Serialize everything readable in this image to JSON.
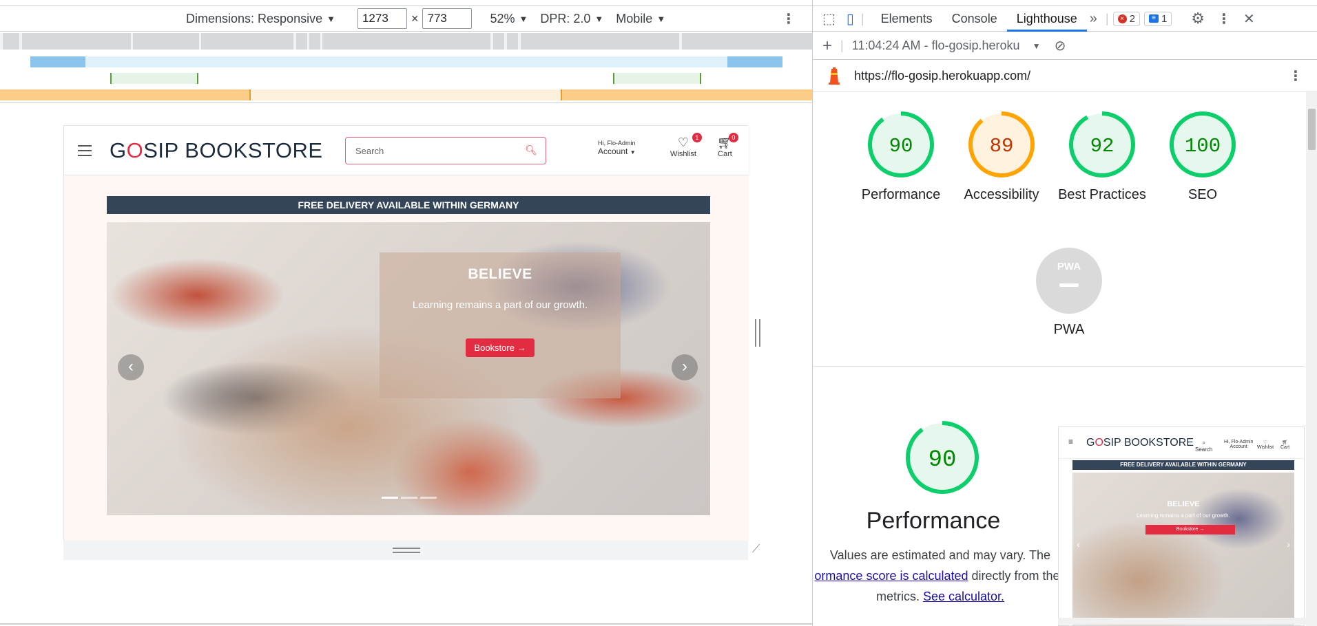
{
  "device_toolbar": {
    "dimensions_label": "Dimensions: Responsive",
    "width_value": "1273",
    "times": "×",
    "height_value": "773",
    "zoom": "52%",
    "dpr": "DPR: 2.0",
    "device_type": "Mobile"
  },
  "website": {
    "logo_g": "G",
    "logo_o": "O",
    "logo_rest": "SIP BOOKSTORE",
    "search_placeholder": "Search",
    "greeting": "Hi, Flo-Admin",
    "account_label": "Account",
    "wishlist_label": "Wishlist",
    "wishlist_count": "1",
    "cart_label": "Cart",
    "cart_count": "0",
    "delivery_banner": "FREE DELIVERY AVAILABLE WITHIN GERMANY",
    "hero_title": "BELIEVE",
    "hero_subtitle": "Learning remains a part of our growth.",
    "hero_button": "Bookstore →"
  },
  "devtools": {
    "tabs": [
      "Elements",
      "Console",
      "Lighthouse"
    ],
    "active_tab": "Lighthouse",
    "error_count": "2",
    "message_count": "1",
    "report_time": "11:04:24 AM - flo-gosip.heroku",
    "url": "https://flo-gosip.herokuapp.com/",
    "scores": [
      {
        "name": "Performance",
        "score": 90,
        "color": "#0cce6b",
        "text_color": "#008800"
      },
      {
        "name": "Accessibility",
        "score": 89,
        "color": "#ffa400",
        "text_color": "#c33300"
      },
      {
        "name": "Best Practices",
        "score": 92,
        "color": "#0cce6b",
        "text_color": "#008800"
      },
      {
        "name": "SEO",
        "score": 100,
        "color": "#0cce6b",
        "text_color": "#008800"
      }
    ],
    "pwa_badge": "PWA",
    "pwa_label": "PWA",
    "perf_score": "90",
    "perf_title": "Performance",
    "perf_desc_1": "Values are estimated and may vary. The",
    "perf_desc_link": "ormance score is calculated",
    "perf_desc_2": "directly from thes",
    "perf_desc_3": "metrics.",
    "perf_desc_calc": "See calculator.",
    "thumb": {
      "logo_g": "G",
      "logo_o": "O",
      "logo_rest": "SIP BOOKSTORE",
      "search": "Search",
      "greeting": "Hi, Flo-Admin",
      "account": "Account",
      "wishlist": "Wishlist",
      "cart": "Cart",
      "banner": "FREE DELIVERY AVAILABLE WITHIN GERMANY",
      "title": "BELIEVE",
      "subtitle": "Learning remains a part of our growth.",
      "button": "Bookstore →"
    }
  }
}
